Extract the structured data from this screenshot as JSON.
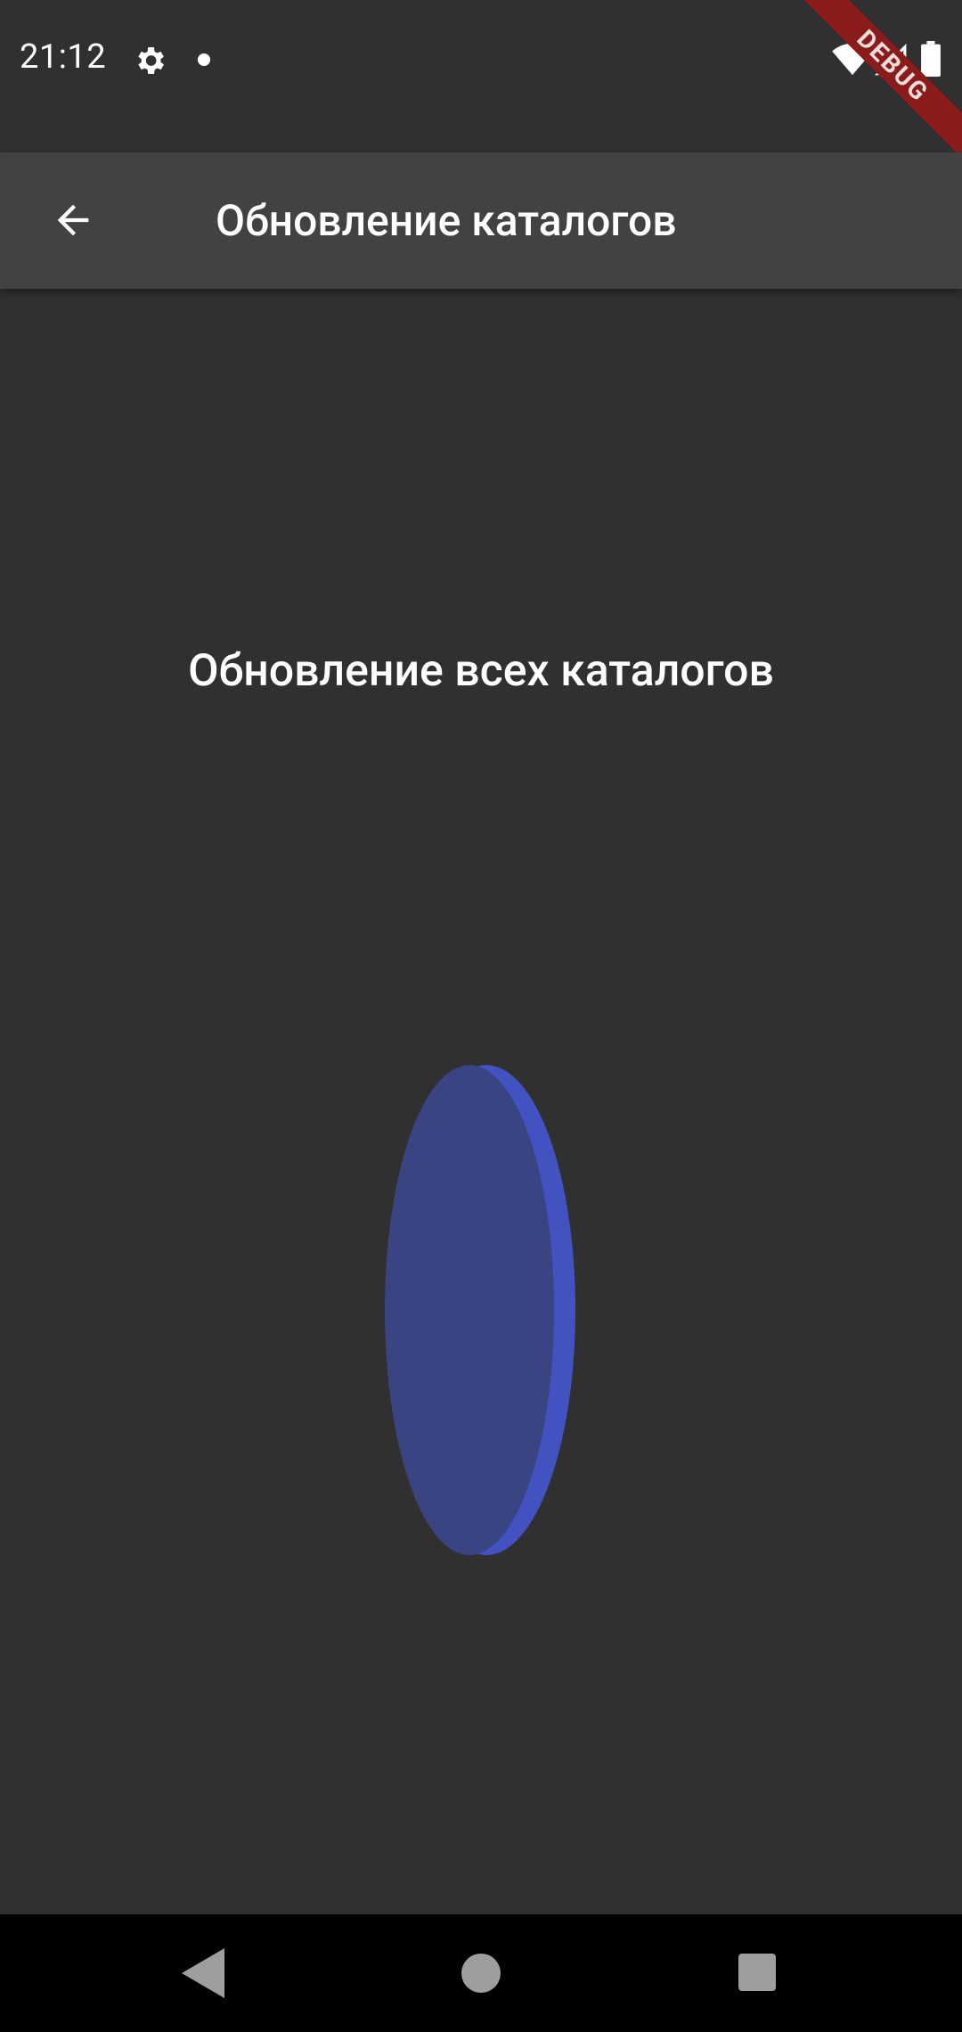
{
  "status_bar": {
    "time": "21:12",
    "icons": [
      "gear-icon",
      "notification-dot-icon",
      "wifi-icon",
      "signal-icon",
      "battery-icon"
    ]
  },
  "debug_banner": {
    "label": "DEBUG",
    "color": "#8b1c1c"
  },
  "app_bar": {
    "title": "Обновление каталогов",
    "back_icon": "arrow-back-icon",
    "background": "#424242"
  },
  "content": {
    "heading": "Обновление всех каталогов",
    "spinner_icon": "flipping-coin-spinner-icon",
    "spinner_colors": {
      "face": "#3b4482",
      "edge": "#4252c0"
    }
  },
  "nav_bar": {
    "icons": [
      "nav-back-icon",
      "nav-home-icon",
      "nav-recents-icon"
    ]
  },
  "colors": {
    "background": "#303030",
    "text": "#ffffff"
  }
}
